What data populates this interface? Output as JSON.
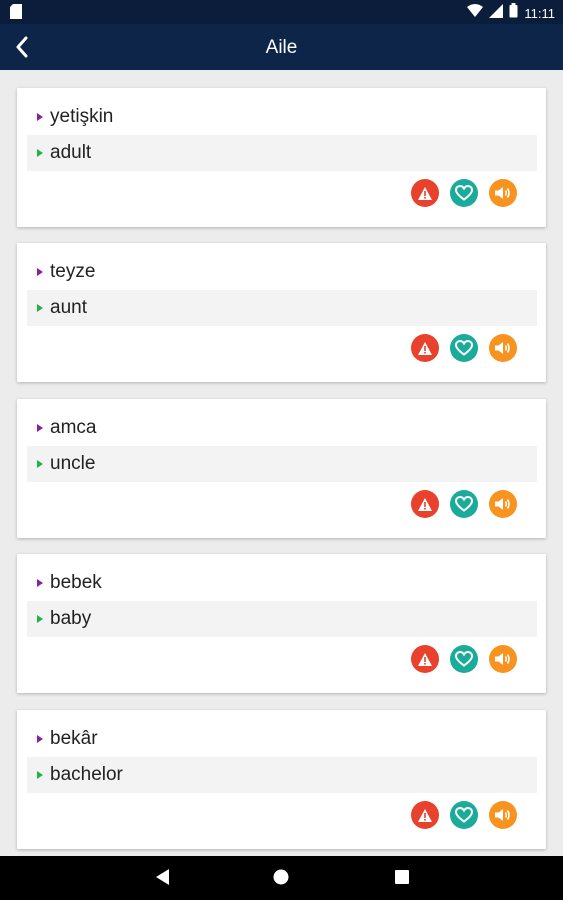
{
  "status_bar": {
    "time": "11:11",
    "icons": [
      "sim-card-icon",
      "wifi-icon",
      "signal-icon",
      "battery-icon"
    ]
  },
  "app_bar": {
    "title": "Aile",
    "back_icon": "back-arrow-icon"
  },
  "cards": [
    {
      "term": "yetişkin",
      "translation": "adult"
    },
    {
      "term": "teyze",
      "translation": "aunt"
    },
    {
      "term": "amca",
      "translation": "uncle"
    },
    {
      "term": "bebek",
      "translation": "baby"
    },
    {
      "term": "bekâr",
      "translation": "bachelor"
    }
  ],
  "card_actions": {
    "report_icon": "warning-icon",
    "favorite_icon": "heart-icon",
    "sound_icon": "speaker-icon"
  },
  "nav_bar": {
    "icons": [
      "back-triangle-icon",
      "home-circle-icon",
      "recents-square-icon"
    ]
  },
  "colors": {
    "app_bar": "#0d2549",
    "status_bar": "#0b1d3a",
    "term_marker": "#8a1fa3",
    "translation_marker": "#22b14c",
    "report": "#e8412c",
    "favorite": "#1aab9b",
    "sound": "#f7931e"
  }
}
